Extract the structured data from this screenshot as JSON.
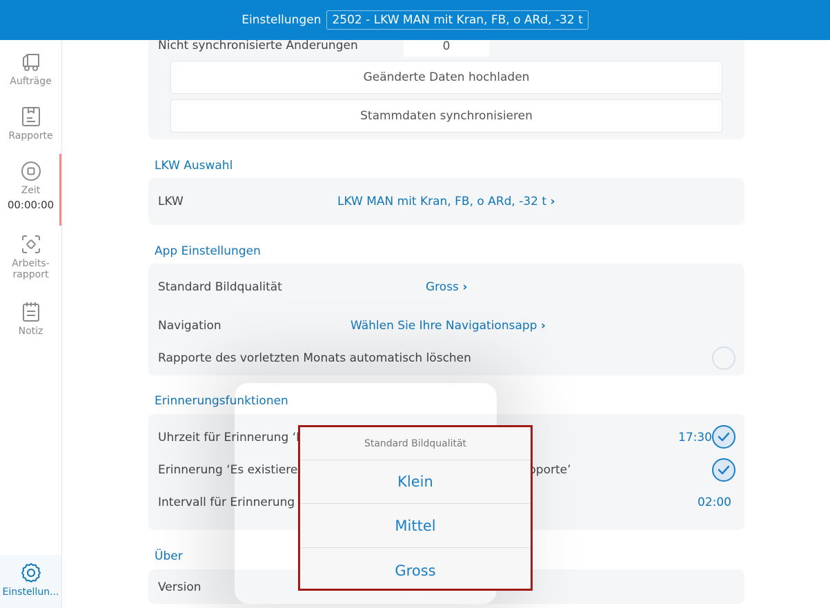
{
  "header": {
    "title": "Einstellungen",
    "vehicle": "2502 - LKW MAN mit Kran, FB, o ARd, -32 t"
  },
  "sidebar": {
    "items": [
      {
        "label": "Aufträge"
      },
      {
        "label": "Rapporte"
      },
      {
        "label": "Zeit",
        "sub": "00:00:00"
      },
      {
        "label": "Arbeits-\nrapport"
      },
      {
        "label": "Notiz"
      }
    ],
    "settings_label": "Einstellun..."
  },
  "sync": {
    "pending_label": "Nicht synchronisierte Änderungen",
    "pending_count": "0",
    "upload_button": "Geänderte Daten hochladen",
    "sync_button": "Stammdaten synchronisieren"
  },
  "truck": {
    "section_title": "LKW Auswahl",
    "label": "LKW",
    "value": "LKW MAN mit Kran, FB, o ARd, -32 t"
  },
  "app_settings": {
    "section_title": "App Einstellungen",
    "image_quality_label": "Standard Bildqualität",
    "image_quality_value": "Gross",
    "navigation_label": "Navigation",
    "navigation_value": "Wählen Sie Ihre Navigationsapp",
    "auto_delete_label": "Rapporte des vorletzten Monats automatisch löschen"
  },
  "reminders": {
    "section_title": "Erinnerungsfunktionen",
    "time_label_visible": "Uhrzeit für Erinnerung ‘R",
    "time_value": "17:30",
    "exists_label_visible": "Erinnerung ‘Es existieren",
    "exists_label_tail": "pporte’",
    "interval_label_visible": "Intervall für Erinnerung ‘",
    "interval_value": "02:00"
  },
  "about": {
    "section_title": "Über",
    "version_label": "Version"
  },
  "popover": {
    "title": "Standard Bildqualität",
    "options": [
      "Klein",
      "Mittel",
      "Gross"
    ]
  },
  "colors": {
    "brand": "#0a84d0",
    "accent": "#1275b8",
    "highlight_border": "#a01a1a"
  },
  "icons": [
    "truck-icon",
    "report-icon",
    "stop-icon",
    "work-report-icon",
    "note-icon",
    "gear-icon",
    "chevron-right-icon",
    "check-icon"
  ]
}
